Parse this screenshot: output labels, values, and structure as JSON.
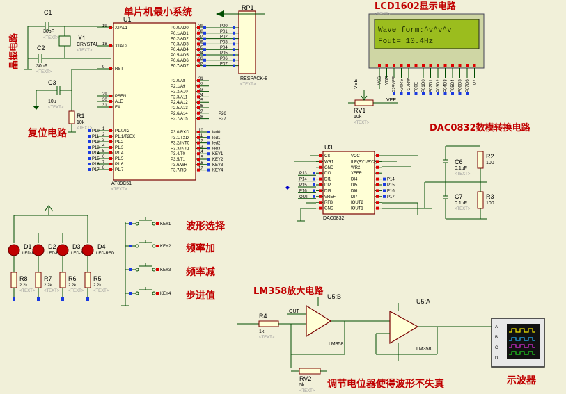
{
  "blocks": {
    "mcu_title": "单片机最小系统",
    "crystal": "晶振电路",
    "reset": "复位电路",
    "lcd_title": "LCD1602显示电路",
    "dac_title": "DAC0832数模转换电路",
    "lm358_title": "LM358放大电路",
    "pot_note": "调节电位器使得波形不失真",
    "scope": "示波器"
  },
  "buttons": [
    "波形选择",
    "频率加",
    "频率减",
    "步进值"
  ],
  "lcd": {
    "line1": "Wave form:^v^v^v",
    "line2": "Fout=     10.4Hz"
  },
  "mcu": {
    "ref": "U1",
    "part": "AT89C51",
    "left_pins": [
      "XTAL1",
      "XTAL2",
      "RST",
      "PSEN",
      "ALE",
      "EA",
      "P1.0/T2",
      "P1.1/T2EX",
      "P1.2",
      "P1.3",
      "P1.4",
      "P1.5",
      "P1.6",
      "P1.7"
    ],
    "left_nums": [
      "19",
      "18",
      "9",
      "29",
      "30",
      "31",
      "1",
      "2",
      "3",
      "4",
      "5",
      "6",
      "7",
      "8"
    ],
    "right_pins": [
      "P0.0/AD0",
      "P0.1/AD1",
      "P0.2/AD2",
      "P0.3/AD3",
      "P0.4/AD4",
      "P0.5/AD5",
      "P0.6/AD6",
      "P0.7/AD7",
      "P2.0/A8",
      "P2.1/A9",
      "P2.2/A10",
      "P2.3/A11",
      "P2.4/A12",
      "P2.5/A13",
      "P2.6/A14",
      "P2.7/A15",
      "P3.0/RXD",
      "P3.1/TXD",
      "P3.2/INT0",
      "P3.3/INT1",
      "P3.4/T0",
      "P3.5/T1",
      "P3.6/WR",
      "P3.7/RD"
    ],
    "right_nums": [
      "39",
      "38",
      "37",
      "36",
      "35",
      "34",
      "33",
      "32",
      "21",
      "22",
      "23",
      "24",
      "25",
      "26",
      "27",
      "28",
      "10",
      "11",
      "12",
      "13",
      "14",
      "15",
      "16",
      "17"
    ],
    "net_p1": [
      "P10",
      "P11",
      "P12",
      "P13",
      "P14",
      "P15",
      "P16",
      "P17"
    ],
    "net_p3": [
      "led0",
      "led1",
      "led2",
      "led3",
      "KEY1",
      "KEY2",
      "KEY3",
      "KEY4"
    ],
    "net_p2": [
      "P26",
      "P27"
    ]
  },
  "rp1": {
    "ref": "RP1",
    "part": "RESPACK-8",
    "nets": [
      "P00",
      "P01",
      "P02",
      "P03",
      "P04",
      "P05",
      "P06",
      "P07"
    ]
  },
  "u3": {
    "ref": "U3",
    "part": "DAC0832",
    "left_pins": [
      "CS",
      "WR1",
      "GND",
      "DI0",
      "DI1",
      "DI2",
      "DI3",
      "VREF",
      "RFB",
      "GND"
    ],
    "right_pins": [
      "VCC",
      "ILE(BY1/BY2)",
      "WR2",
      "XFER",
      "DI4",
      "DI5",
      "DI6",
      "DI7",
      "IOUT2",
      "IOUT1"
    ],
    "left_nets": [
      "",
      "",
      "",
      "P13",
      "P14",
      "P15",
      "P16",
      "OUT",
      "",
      ""
    ],
    "right_nets": [
      "",
      "",
      "",
      "",
      "P14",
      "P15",
      "P16",
      "P17",
      "",
      ""
    ]
  },
  "components": {
    "c1": {
      "ref": "C1",
      "val": "30pF"
    },
    "c2": {
      "ref": "C2",
      "val": "30pF"
    },
    "c3": {
      "ref": "C3",
      "val": "10u"
    },
    "x1": {
      "ref": "X1",
      "val": "CRYSTAL"
    },
    "r1": {
      "ref": "R1",
      "val": "10k"
    },
    "rv1": {
      "ref": "RV1",
      "val": "10k"
    },
    "c6": {
      "ref": "C6",
      "val": "0.1uF"
    },
    "c7": {
      "ref": "C7",
      "val": "0.1uF"
    },
    "r2": {
      "ref": "R2",
      "val": "100"
    },
    "r3": {
      "ref": "R3",
      "val": "100"
    },
    "r4": {
      "ref": "R4",
      "val": "1k"
    },
    "rv2": {
      "ref": "RV2",
      "val": "5k"
    },
    "u5b": {
      "ref": "U5:B",
      "part": "LM358"
    },
    "u5a": {
      "ref": "U5:A",
      "part": "LM358"
    },
    "out_net": "OUT",
    "vee": "VEE"
  },
  "leds": [
    {
      "ref": "D1",
      "part": "LED-RED"
    },
    {
      "ref": "D2",
      "part": "LED-RED"
    },
    {
      "ref": "D3",
      "part": "LED-RED"
    },
    {
      "ref": "D4",
      "part": "LED-RED"
    }
  ],
  "led_res": [
    {
      "ref": "R8",
      "val": "2.2k"
    },
    {
      "ref": "R7",
      "val": "2.2k"
    },
    {
      "ref": "R6",
      "val": "2.2k"
    },
    {
      "ref": "R5",
      "val": "2.2k"
    }
  ],
  "keys": [
    "KEY1",
    "KEY2",
    "KEY3",
    "KEY4"
  ],
  "lcd_pins": [
    "VSS",
    "VDD",
    "VEE",
    "RS",
    "RW",
    "E",
    "D0",
    "D1",
    "D2",
    "D3",
    "D4",
    "D5",
    "D6",
    "D7"
  ],
  "lcd_nets": [
    "P25",
    "P26",
    "P27",
    "P00",
    "P01",
    "P02",
    "P03",
    "P04",
    "P05",
    "P06",
    "P07"
  ],
  "scope_channels": [
    "A",
    "B",
    "C",
    "D"
  ],
  "text_tag": "<TEXT>",
  "colors": {
    "background": "#f1f0d9",
    "wire": "#004c00",
    "label": "#c00000",
    "lcd": "#9bbd1e",
    "scope": "#111111"
  }
}
